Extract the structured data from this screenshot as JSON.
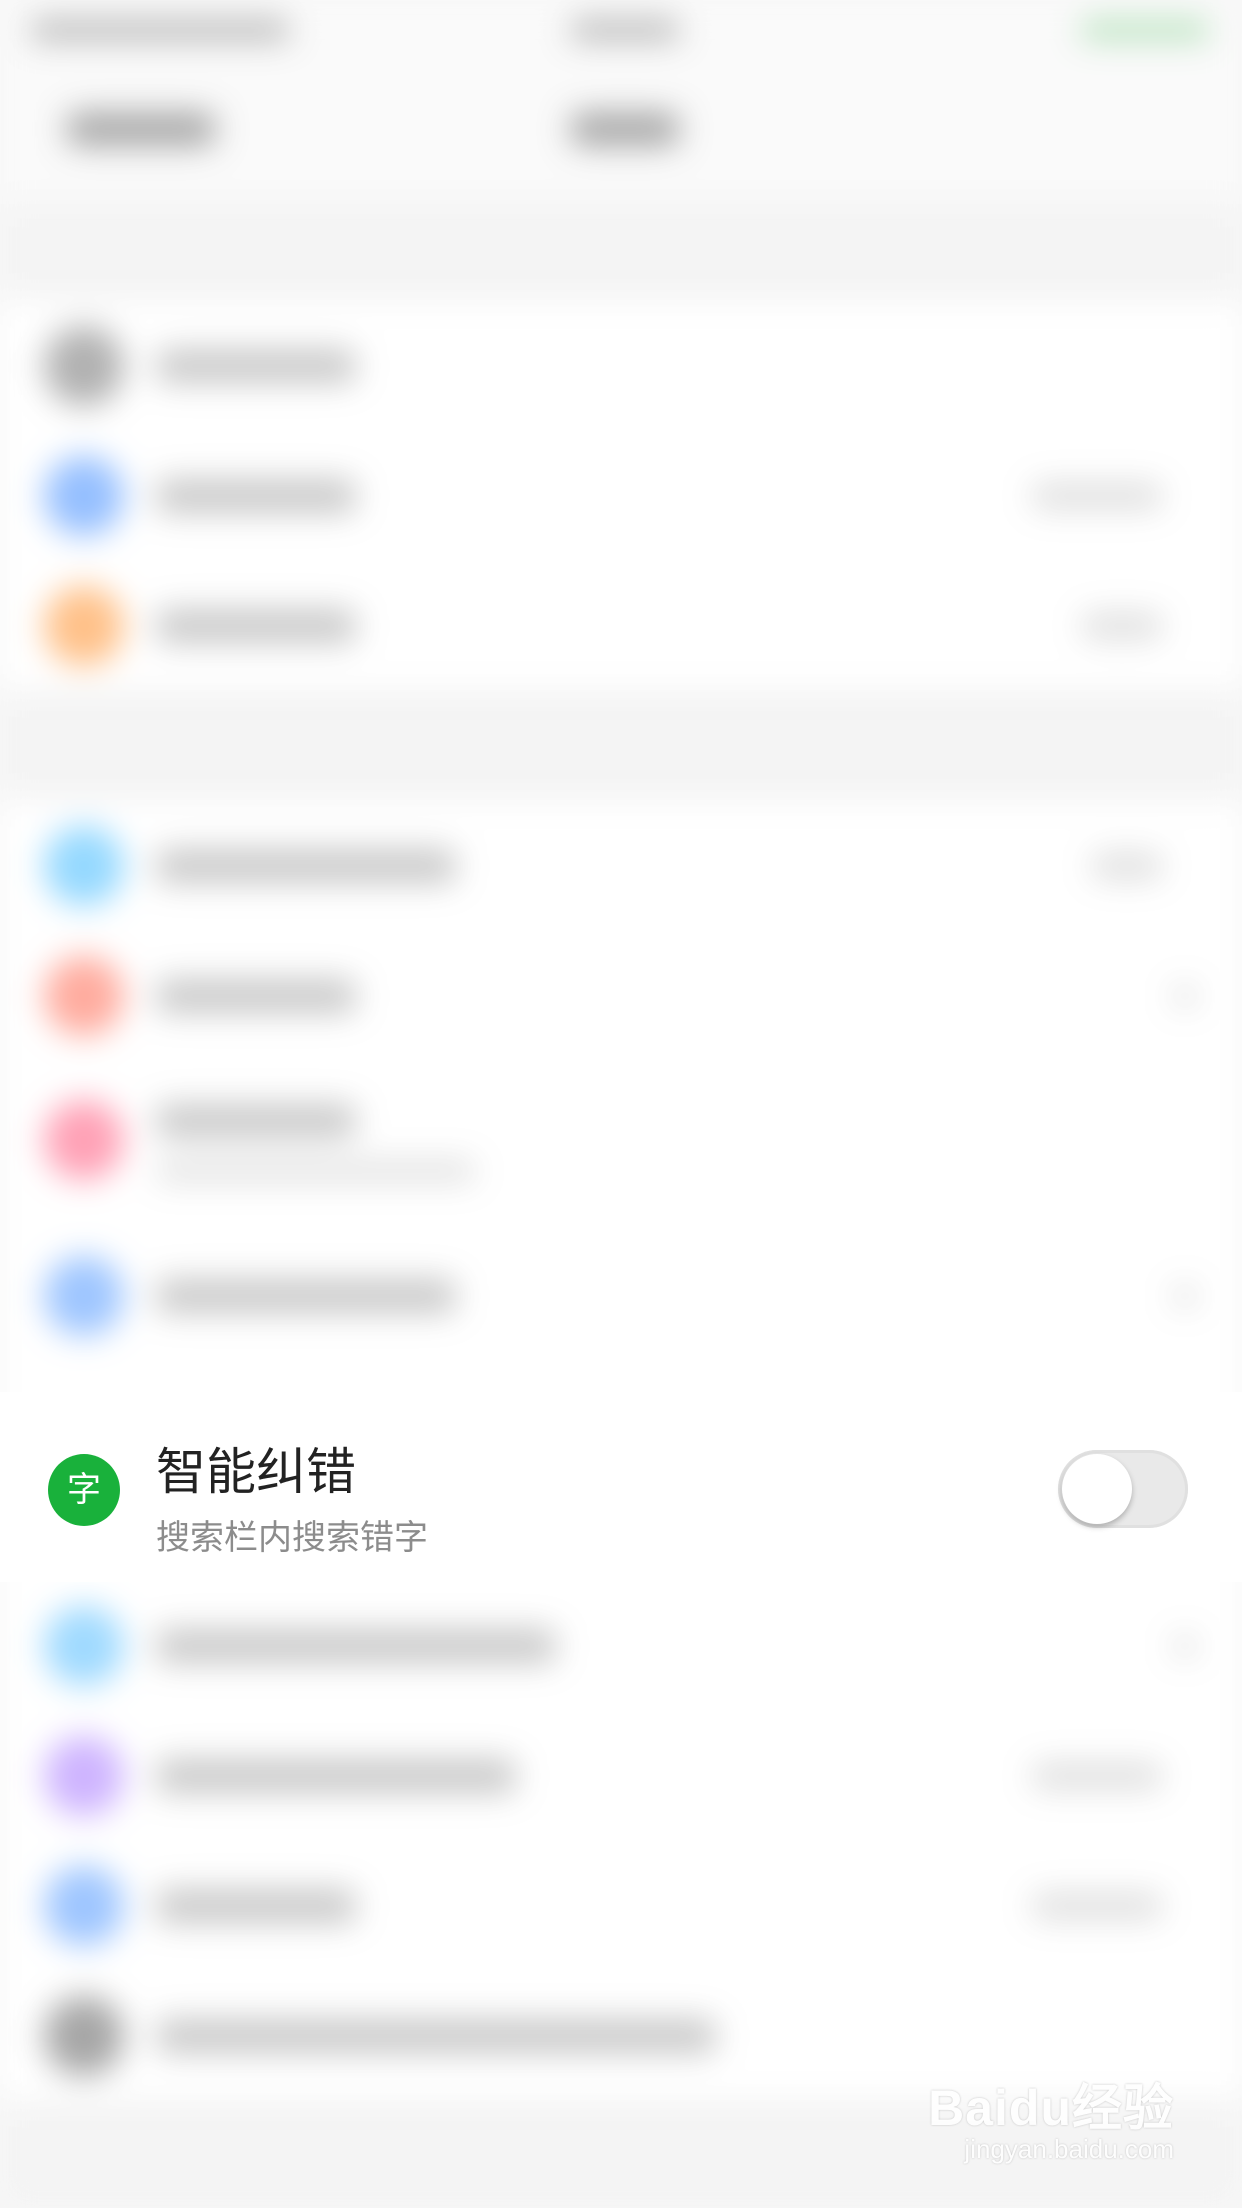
{
  "focus_setting": {
    "icon_glyph": "字",
    "icon_color": "#19b13b",
    "title": "智能纠错",
    "subtitle": "搜索栏内搜索错字",
    "toggle_on": false
  },
  "watermark": {
    "brand": "Baidu经验",
    "url": "jingyan.baidu.com"
  },
  "blurred_rows": [
    {
      "icon": "gear-icon",
      "color": "#888888"
    },
    {
      "icon": "settings-icon",
      "color": "#5c9dff"
    },
    {
      "icon": "settings-icon",
      "color": "#ffa04a"
    },
    {
      "icon": "settings-icon",
      "color": "#5cc4ff"
    },
    {
      "icon": "settings-icon",
      "color": "#ff7f6b"
    },
    {
      "icon": "settings-icon",
      "color": "#ff6f8f"
    },
    {
      "icon": "settings-icon",
      "color": "#6aa7ff"
    },
    {
      "icon": "settings-icon",
      "color": "#6cc6ff"
    },
    {
      "icon": "settings-icon",
      "color": "#b48cff"
    },
    {
      "icon": "settings-icon",
      "color": "#6aa7ff"
    },
    {
      "icon": "settings-icon",
      "color": "#777777"
    }
  ]
}
